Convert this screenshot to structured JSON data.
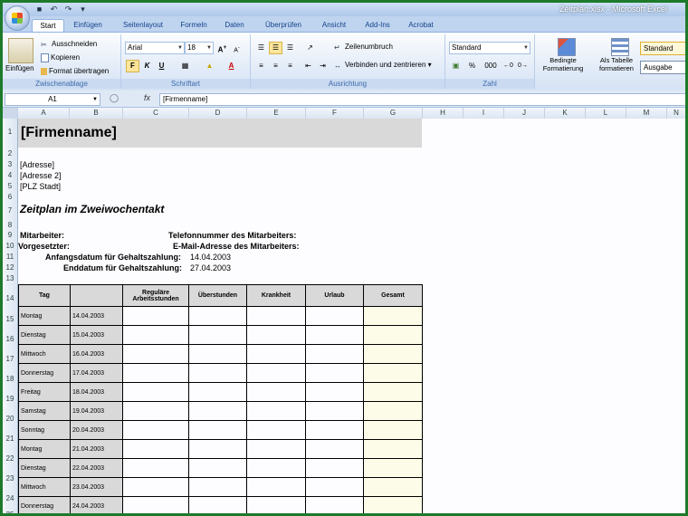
{
  "window": {
    "title": "Zeitplan.xlsx - Microsoft Excel"
  },
  "tabs": [
    "Start",
    "Einfügen",
    "Seitenlayout",
    "Formeln",
    "Daten",
    "Überprüfen",
    "Ansicht",
    "Add-Ins",
    "Acrobat"
  ],
  "ribbon": {
    "clipboard": {
      "paste": "Einfügen",
      "cut": "Ausschneiden",
      "copy": "Kopieren",
      "format_painter": "Format übertragen",
      "label": "Zwischenablage"
    },
    "font": {
      "name": "Arial",
      "size": "18",
      "bold": "F",
      "italic": "K",
      "underline": "U",
      "label": "Schriftart"
    },
    "alignment": {
      "wrap": "Zeilenumbruch",
      "merge": "Verbinden und zentrieren",
      "label": "Ausrichtung"
    },
    "number": {
      "format": "Standard",
      "percent": "%",
      "thousands": "000",
      "label": "Zahl"
    },
    "styles": {
      "conditional": "Bedingte Formatierung",
      "as_table": "Als Tabelle formatieren",
      "standard": "Standard",
      "output": "Ausgabe"
    }
  },
  "formula_bar": {
    "name_box": "A1",
    "fx": "fx",
    "value": "[Firmenname]"
  },
  "columns": [
    "A",
    "B",
    "C",
    "D",
    "E",
    "F",
    "G",
    "H",
    "I",
    "J",
    "K",
    "L",
    "M",
    "N"
  ],
  "rows": [
    "1",
    "2",
    "3",
    "4",
    "5",
    "6",
    "7",
    "8",
    "9",
    "10",
    "11",
    "12",
    "13",
    "14",
    "15",
    "16",
    "17",
    "18",
    "19",
    "20",
    "21",
    "22",
    "23",
    "24",
    "25"
  ],
  "sheet": {
    "company": "[Firmenname]",
    "address1": "[Adresse]",
    "address2": "[Adresse 2]",
    "city": "[PLZ Stadt]",
    "heading": "Zeitplan im Zweiwochentakt",
    "employee_label": "Mitarbeiter:",
    "phone_label": "Telefonnummer des Mitarbeiters:",
    "supervisor_label": "Vorgesetzter:",
    "email_label": "E-Mail-Adresse des Mitarbeiters:",
    "start_label": "Anfangsdatum für Gehaltszahlung:",
    "start_value": "14.04.2003",
    "end_label": "Enddatum für Gehaltszahlung:",
    "end_value": "27.04.2003",
    "table_headers": [
      "Tag",
      "",
      "Reguläre Arbeitsstunden",
      "Überstunden",
      "Krankheit",
      "Urlaub",
      "Gesamt"
    ],
    "table_rows": [
      {
        "day": "Montag",
        "date": "14.04.2003"
      },
      {
        "day": "Dienstag",
        "date": "15.04.2003"
      },
      {
        "day": "Mittwoch",
        "date": "16.04.2003"
      },
      {
        "day": "Donnerstag",
        "date": "17.04.2003"
      },
      {
        "day": "Freitag",
        "date": "18.04.2003"
      },
      {
        "day": "Samstag",
        "date": "19.04.2003"
      },
      {
        "day": "Sonntag",
        "date": "20.04.2003"
      },
      {
        "day": "Montag",
        "date": "21.04.2003"
      },
      {
        "day": "Dienstag",
        "date": "22.04.2003"
      },
      {
        "day": "Mittwoch",
        "date": "23.04.2003"
      },
      {
        "day": "Donnerstag",
        "date": "24.04.2003"
      }
    ]
  }
}
